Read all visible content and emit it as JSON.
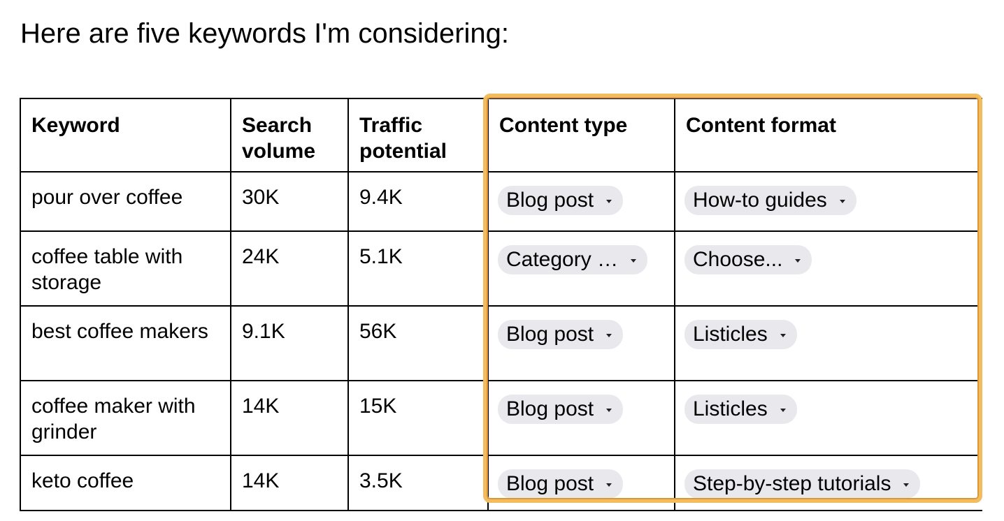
{
  "intro_text": "Here are five keywords I'm considering:",
  "highlight_color": "#f2bc5f",
  "table": {
    "headers": {
      "keyword": "Keyword",
      "search_volume": "Search volume",
      "traffic_potential": "Traffic potential",
      "content_type": "Content type",
      "content_format": "Content format"
    },
    "rows": [
      {
        "keyword": "pour over coffee",
        "search_volume": "30K",
        "traffic_potential": "9.4K",
        "content_type": "Blog post",
        "content_format": "How-to guides"
      },
      {
        "keyword": "coffee table with storage",
        "search_volume": "24K",
        "traffic_potential": "5.1K",
        "content_type": "Category …",
        "content_format": "Choose..."
      },
      {
        "keyword": "best coffee makers",
        "search_volume": "9.1K",
        "traffic_potential": "56K",
        "content_type": "Blog post",
        "content_format": "Listicles"
      },
      {
        "keyword": "coffee maker with grinder",
        "search_volume": "14K",
        "traffic_potential": "15K",
        "content_type": "Blog post",
        "content_format": "Listicles"
      },
      {
        "keyword": "keto coffee",
        "search_volume": "14K",
        "traffic_potential": "3.5K",
        "content_type": "Blog post",
        "content_format": "Step-by-step tutorials"
      }
    ]
  }
}
